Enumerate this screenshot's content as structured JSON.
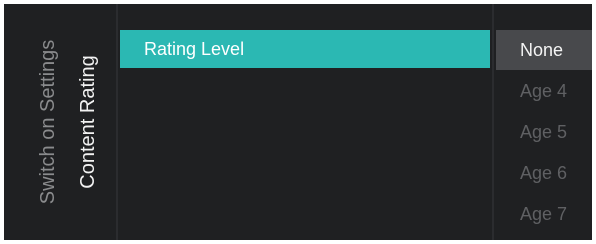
{
  "breadcrumb": {
    "parent": "Switch on Settings",
    "current": "Content Rating"
  },
  "menu": {
    "items": [
      {
        "label": "Rating Level",
        "selected": true
      }
    ]
  },
  "options": {
    "selected_index": 0,
    "items": [
      {
        "label": "None"
      },
      {
        "label": "Age 4"
      },
      {
        "label": "Age 5"
      },
      {
        "label": "Age 6"
      },
      {
        "label": "Age 7"
      }
    ]
  },
  "colors": {
    "accent": "#2bb8b3",
    "background": "#1f2022",
    "option_selected_bg": "#48494c"
  }
}
